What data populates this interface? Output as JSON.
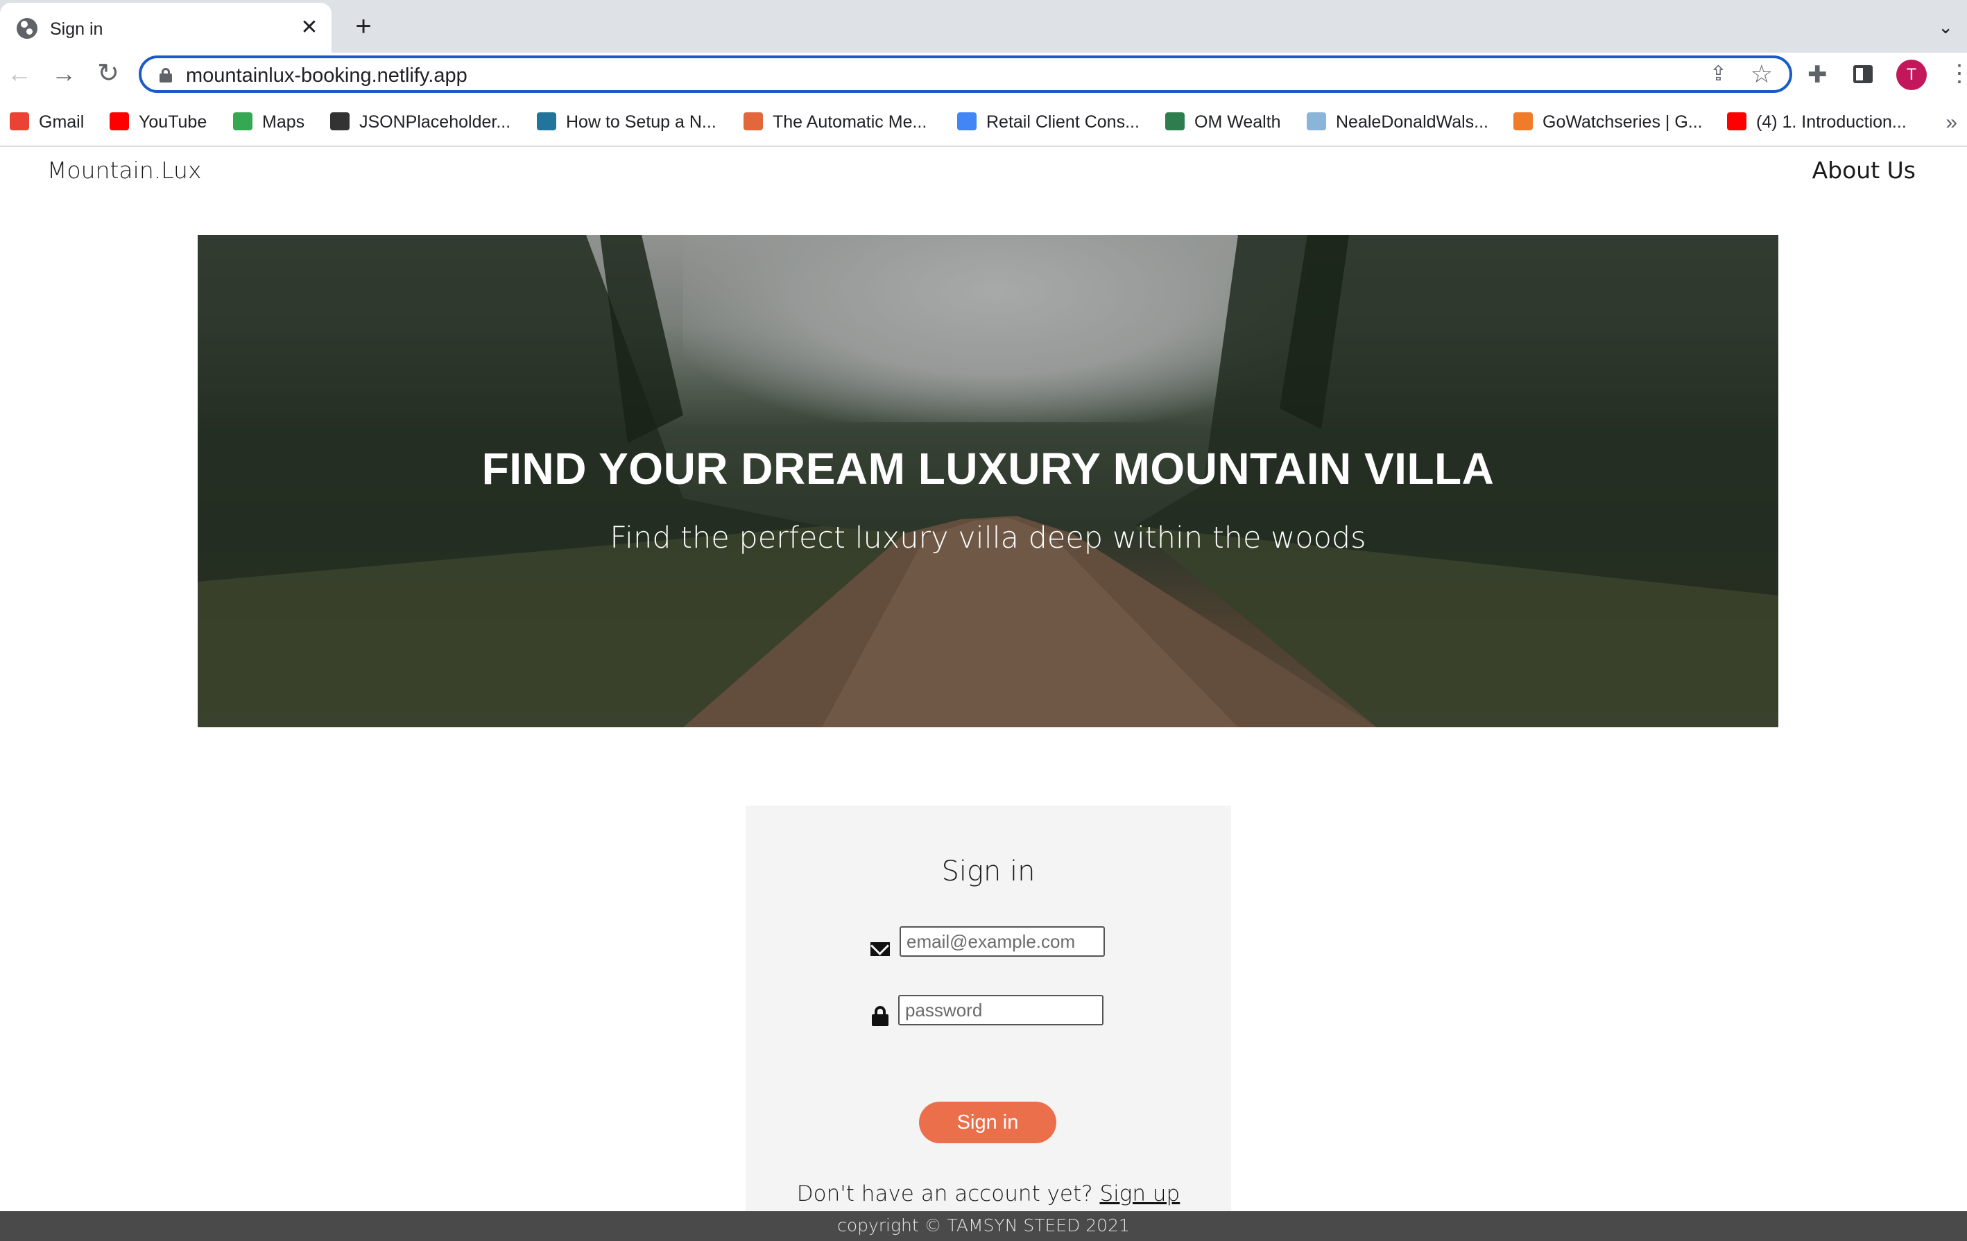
{
  "browser": {
    "tab": {
      "title": "Sign in",
      "close": "✕"
    },
    "new_tab": "+",
    "tab_menu": "⌄",
    "nav": {
      "back": "←",
      "forward": "→",
      "reload": "↻"
    },
    "url": "mountainlux-booking.netlify.app",
    "profile_initial": "T",
    "menu": "⋮",
    "bookmarks": [
      {
        "label": "Gmail",
        "icon": "gmail-icon",
        "color": "#ea4335"
      },
      {
        "label": "YouTube",
        "icon": "youtube-icon",
        "color": "#ff0000"
      },
      {
        "label": "Maps",
        "icon": "maps-icon",
        "color": "#34a853"
      },
      {
        "label": "JSONPlaceholder...",
        "icon": "jsonplaceholder-icon",
        "color": "#333333"
      },
      {
        "label": "How to Setup a N...",
        "icon": "wordpress-icon",
        "color": "#21759b"
      },
      {
        "label": "The Automatic Me...",
        "icon": "automatic-icon",
        "color": "#e2673b"
      },
      {
        "label": "Retail Client Cons...",
        "icon": "google-icon",
        "color": "#4285f4"
      },
      {
        "label": "OM Wealth",
        "icon": "om-wealth-icon",
        "color": "#2e7d4f"
      },
      {
        "label": "NealeDonaldWals...",
        "icon": "nealedonaldwalsch-icon",
        "color": "#8ab4d8"
      },
      {
        "label": "GoWatchseries | G...",
        "icon": "gowatchseries-icon",
        "color": "#f07b2a"
      },
      {
        "label": "(4) 1. Introduction...",
        "icon": "youtube-icon",
        "color": "#ff0000"
      }
    ],
    "bookmarks_more": "»"
  },
  "site": {
    "brand": "Mountain.Lux",
    "nav_about": "About Us"
  },
  "hero": {
    "title": "FIND YOUR DREAM LUXURY MOUNTAIN VILLA",
    "subtitle": "Find the perfect luxury villa deep within the woods"
  },
  "signin": {
    "title": "Sign in",
    "email_placeholder": "email@example.com",
    "password_placeholder": "password",
    "button": "Sign in",
    "no_account": "Don't have an account yet?",
    "signup_link": "Sign up"
  },
  "footer": {
    "text": "copyright © TAMSYN STEED 2021"
  },
  "colors": {
    "accent": "#ec6f4c",
    "footer_bg": "#4a4a4a",
    "card_bg": "#f4f4f4",
    "omnibox_focus": "#1a5bc7",
    "avatar": "#c2185b"
  }
}
